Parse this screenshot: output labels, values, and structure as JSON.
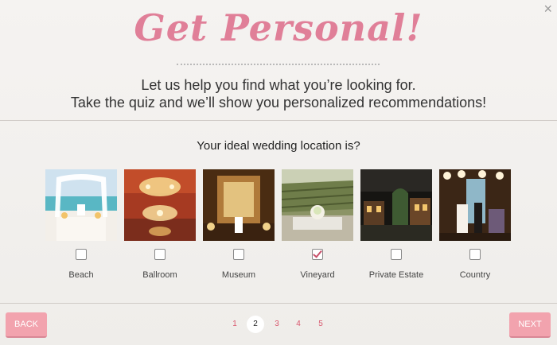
{
  "title": "Get Personal!",
  "intro": {
    "line1": "Let us help you find what you’re looking for.",
    "line2": "Take the quiz and we’ll show you personalized recommendations!"
  },
  "question": "Your ideal wedding location is?",
  "options": [
    {
      "label": "Beach",
      "checked": false
    },
    {
      "label": "Ballroom",
      "checked": false
    },
    {
      "label": "Museum",
      "checked": false
    },
    {
      "label": "Vineyard",
      "checked": true
    },
    {
      "label": "Private Estate",
      "checked": false
    },
    {
      "label": "Country",
      "checked": false
    }
  ],
  "pagination": {
    "pages": [
      "1",
      "2",
      "3",
      "4",
      "5"
    ],
    "current": "2"
  },
  "buttons": {
    "back": "BACK",
    "next": "NEXT"
  },
  "close_icon": "×",
  "colors": {
    "accent": "#e07f98",
    "button": "#f2a3ae",
    "page_link": "#d9596f"
  }
}
